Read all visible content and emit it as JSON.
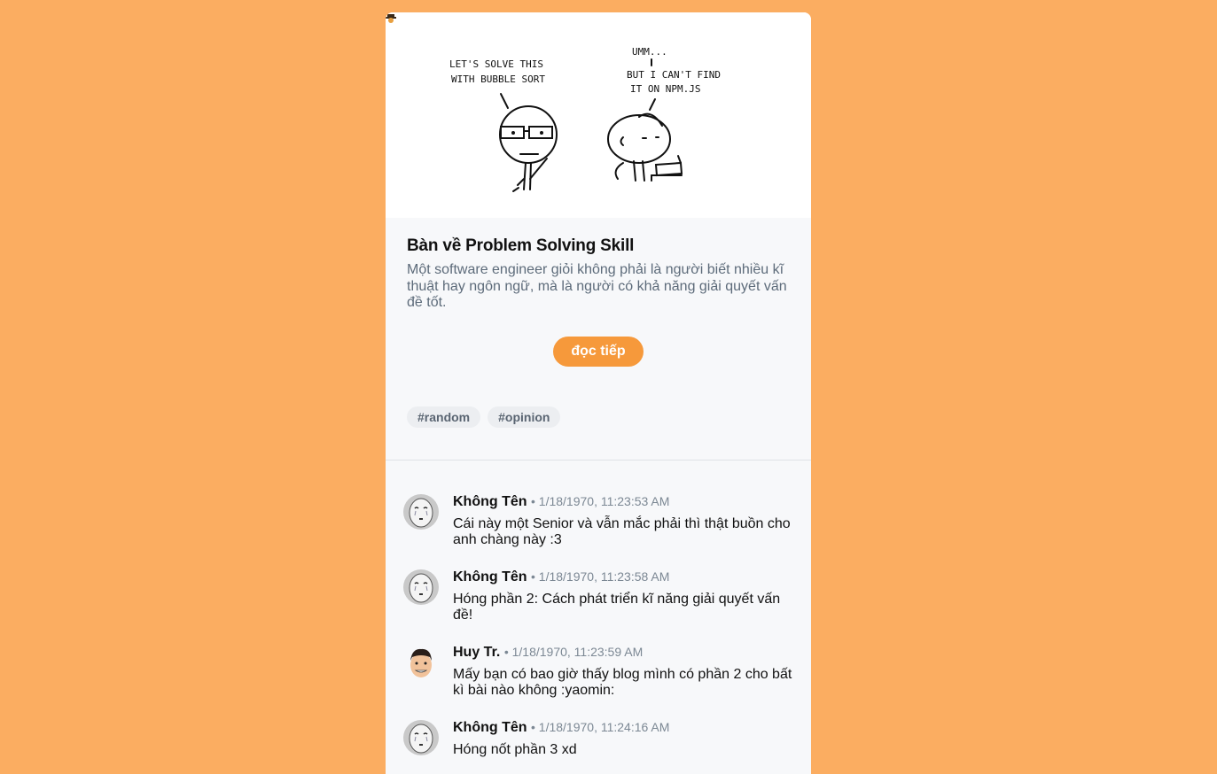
{
  "comic": {
    "left_speech": [
      "LET'S SOLVE THIS",
      "WITH BUBBLE SORT"
    ],
    "right_speech": [
      "UMM...",
      "BUT I CAN'T FIND",
      "IT ON NPM.JS"
    ]
  },
  "post": {
    "title": "Bàn về Problem Solving Skill",
    "excerpt": "Một software engineer giỏi không phải là người biết nhiều kĩ thuật hay ngôn ngữ, mà là người có khả năng giải quyết vấn đề tốt.",
    "read_more": "đọc tiếp",
    "tags": [
      "#random",
      "#opinion"
    ]
  },
  "comments": [
    {
      "author": "Không Tên",
      "time": "• 1/18/1970, 11:23:53 AM",
      "text": "Cái này một Senior và vẫn mắc phải thì thật buồn cho anh chàng này :3",
      "avatar": "noface-avatar"
    },
    {
      "author": "Không Tên",
      "time": "• 1/18/1970, 11:23:58 AM",
      "text": "Hóng phần 2: Cách phát triển kĩ năng giải quyết vấn đề!",
      "avatar": "noface-avatar"
    },
    {
      "author": "Huy Tr.",
      "time": "• 1/18/1970, 11:23:59 AM",
      "text": "Mấy bạn có bao giờ thấy blog mình có phần 2 cho bất kì bài nào không :yaomin:",
      "avatar": "person-avatar"
    },
    {
      "author": "Không Tên",
      "time": "• 1/18/1970, 11:24:16 AM",
      "text": "Hóng nốt phần 3 xd",
      "avatar": "noface-avatar"
    }
  ],
  "colors": {
    "background": "#fbad61",
    "accent": "#f6993b",
    "card": "#f7f8fa"
  }
}
